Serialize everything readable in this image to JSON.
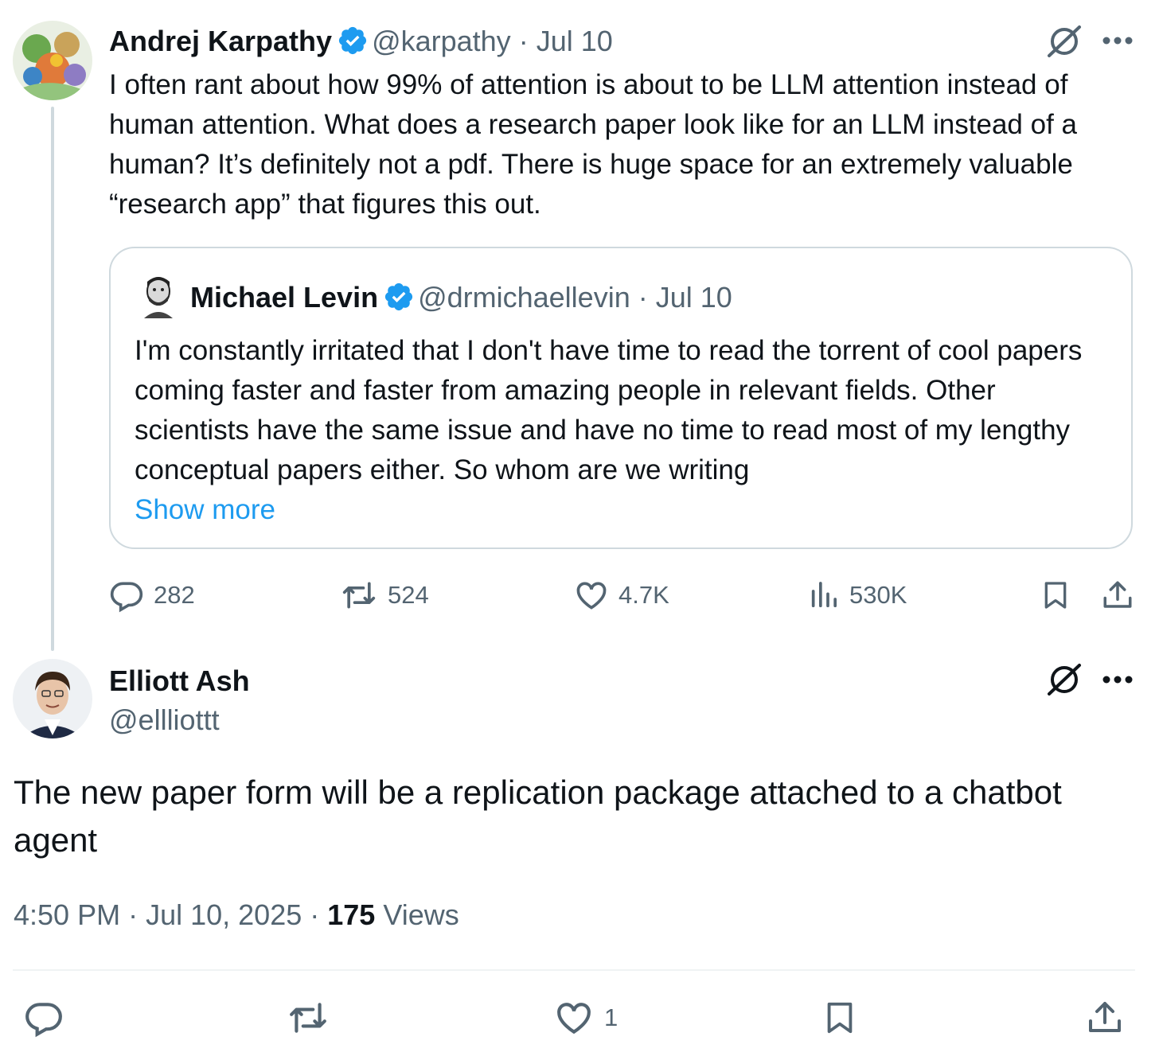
{
  "parent": {
    "name": "Andrej Karpathy",
    "handle": "@karpathy",
    "date": "Jul 10",
    "text": "I often rant about how 99% of attention is about to be LLM attention instead of human attention. What does a research paper look like for an LLM instead of a human? It’s definitely not a pdf. There is huge space for an extremely valuable “research app” that figures this out.",
    "quote": {
      "name": "Michael Levin",
      "handle": "@drmichaellevin",
      "date": "Jul 10",
      "text": "I'm constantly irritated that I don't have time to read the torrent of cool papers coming faster and faster from amazing people in relevant fields. Other scientists have the same issue and have no time to read most of my lengthy conceptual papers either.  So whom are we writing",
      "show_more": "Show more"
    },
    "actions": {
      "replies": "282",
      "reposts": "524",
      "likes": "4.7K",
      "views": "530K"
    }
  },
  "reply": {
    "name": "Elliott Ash",
    "handle": "@ellliottt",
    "text": "The new paper form will be a replication package attached to a chatbot agent",
    "time": "4:50 PM",
    "date": "Jul 10, 2025",
    "views_count": "175",
    "views_label": "Views",
    "actions": {
      "likes": "1"
    }
  },
  "colors": {
    "verified": "#1d9bf0",
    "muted": "#536471",
    "link": "#1d9bf0",
    "text": "#0f1419"
  }
}
